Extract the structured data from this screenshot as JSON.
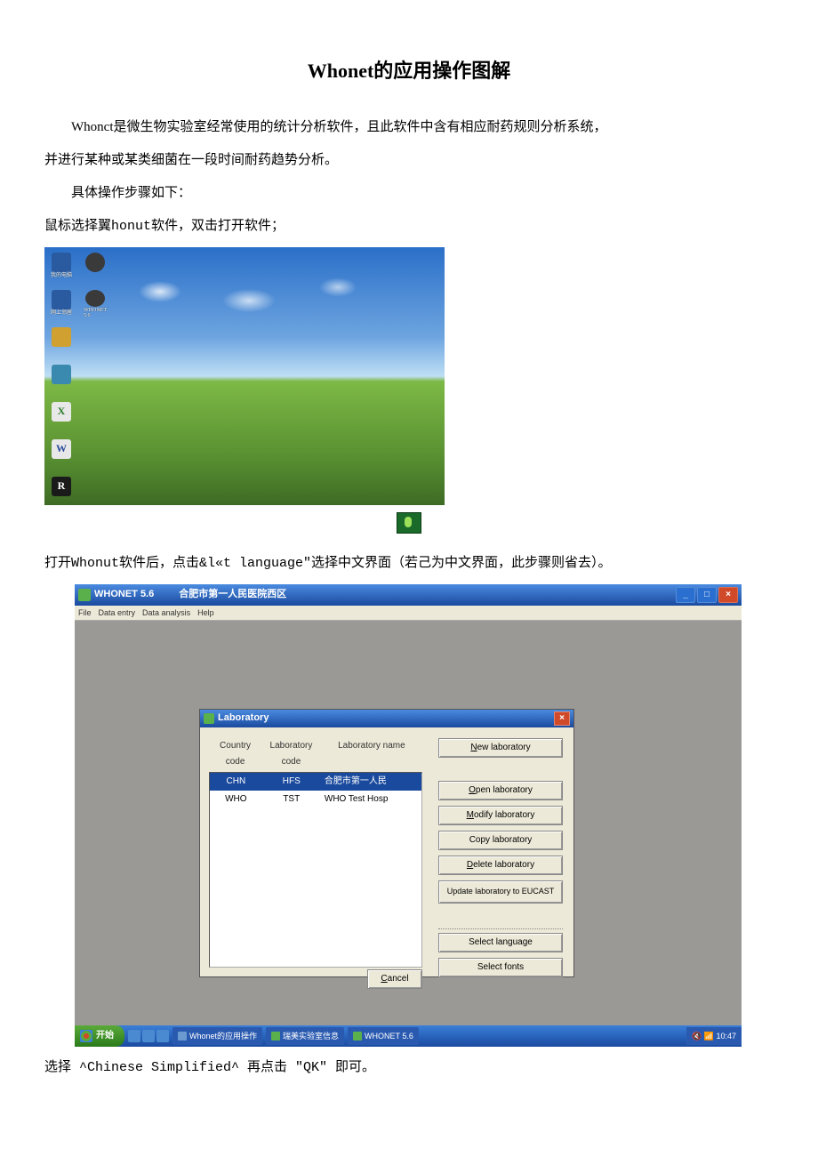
{
  "doc": {
    "title": "Whonet的应用操作图解",
    "intro": "Whonct是微生物实验室经常使用的统计分析软件，且此软件中含有相应耐药规则分析系统，",
    "intro2": "并进行某种或某类细菌在一段时间耐药趋势分析。",
    "steps_header": "具体操作步骤如下：",
    "step1": "鼠标选择翼honut软件，双击打开软件；",
    "step2": "打开Whonut软件后，点击&l«t language\"选择中文界面（若己为中文界面，此步骤则省去）。",
    "step3": "选择 ^Chinese Simplified^ 再点击 \"QK\" 即可。"
  },
  "desktop": {
    "icons": [
      {
        "label": "",
        "bg": "#2a5aa0"
      },
      {
        "label": "",
        "bg": "#2a5aa0"
      },
      {
        "label": "",
        "bg": "#d0a030"
      },
      {
        "label": "",
        "bg": "#3a8ab0"
      },
      {
        "label": "X",
        "bg": "#e8e8e8"
      },
      {
        "label": "W",
        "bg": "#e8e8e8"
      },
      {
        "label": "R",
        "bg": "#1a1a1a"
      },
      {
        "label": "",
        "bg": "#d0b040"
      }
    ]
  },
  "whonet": {
    "app_title": "WHONET 5.6",
    "app_subtitle": "合肥市第一人民医院西区",
    "menu": [
      "File",
      "Data entry",
      "Data analysis",
      "Help"
    ],
    "dialog_title": "Laboratory",
    "columns": {
      "c1": "Country code",
      "c2": "Laboratory code",
      "c3": "Laboratory name"
    },
    "rows": [
      {
        "c1": "CHN",
        "c2": "HFS",
        "c3": "合肥市第一人民"
      },
      {
        "c1": "WHO",
        "c2": "TST",
        "c3": "WHO Test Hosp"
      }
    ],
    "buttons": {
      "new": "New laboratory",
      "open": "Open laboratory",
      "modify": "Modify laboratory",
      "copy": "Copy laboratory",
      "delete": "Delete laboratory",
      "update": "Update laboratory to EUCAST",
      "lang": "Select language",
      "fonts": "Select fonts",
      "cancel": "Cancel"
    },
    "taskbar": {
      "start": "开始",
      "items": [
        "Whonet的应用操作",
        "瑞美实验室信息",
        "WHONET 5.6"
      ],
      "time": "10:47"
    }
  }
}
